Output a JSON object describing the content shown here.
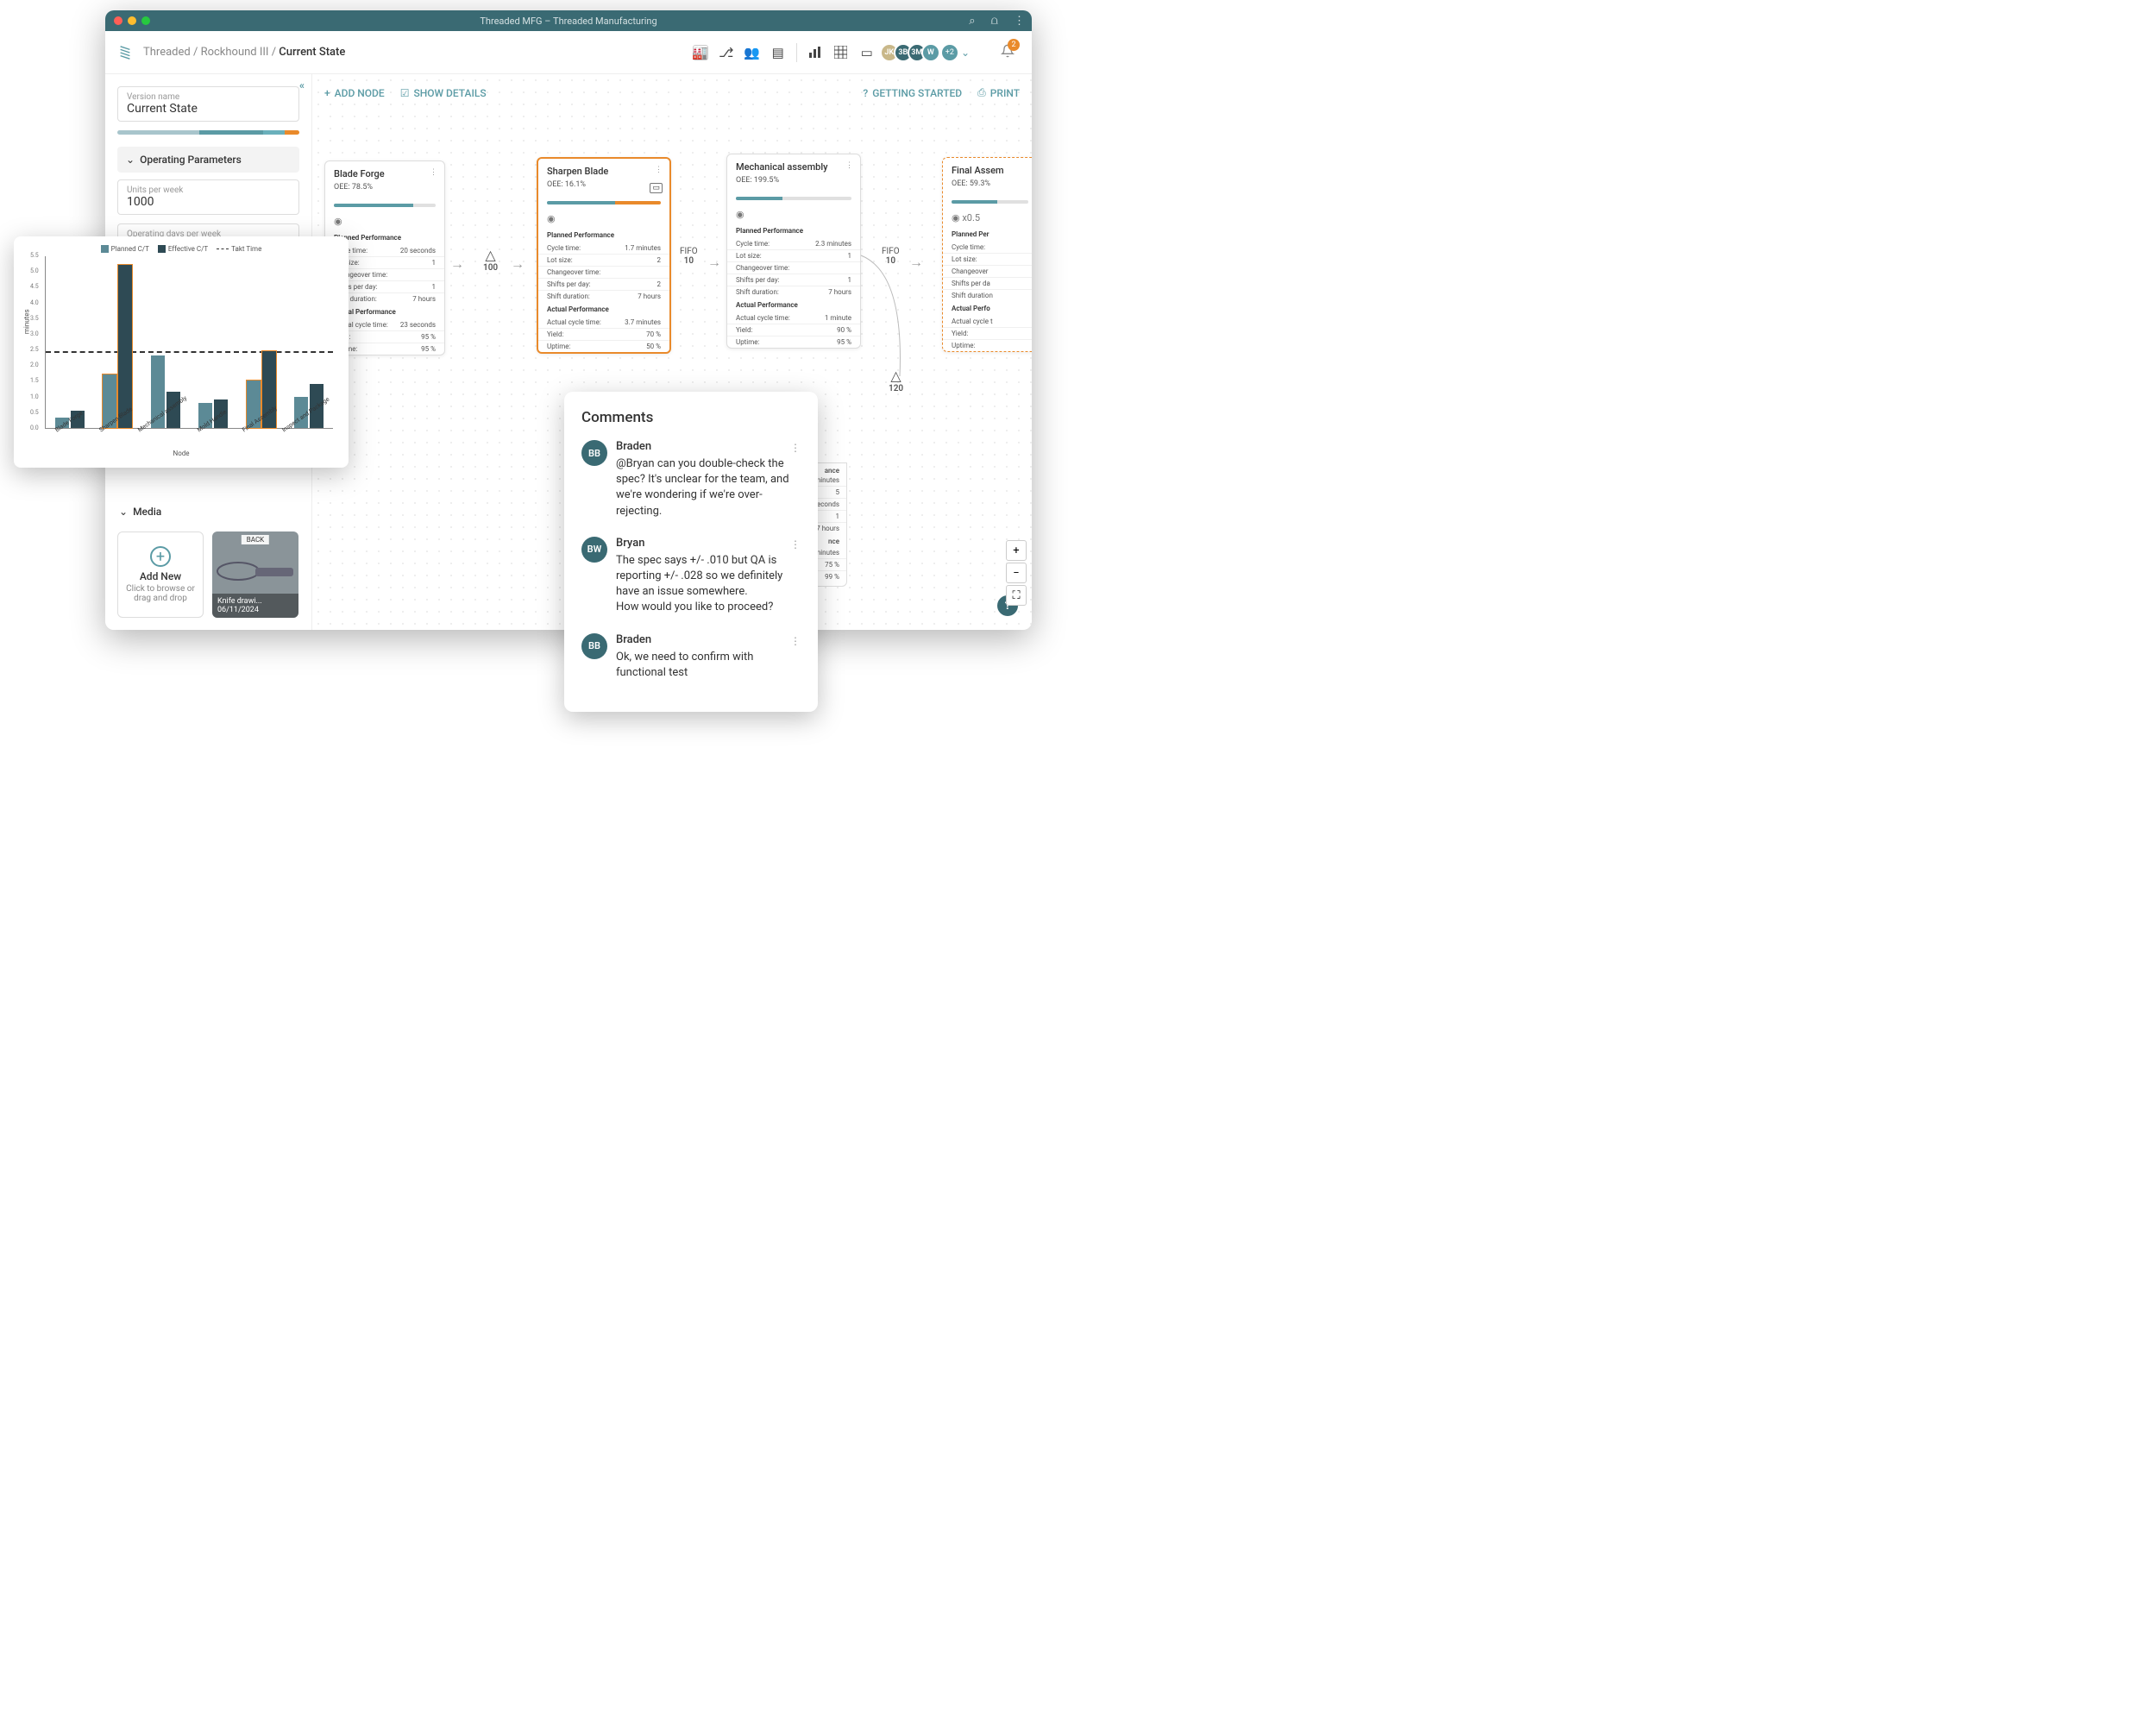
{
  "window_title": "Threaded MFG – Threaded Manufacturing",
  "breadcrumbs": {
    "root": "Threaded",
    "project": "Rockhound III",
    "current": "Current State"
  },
  "sidebar": {
    "version_label": "Version name",
    "version_value": "Current State",
    "op_params_title": "Operating Parameters",
    "units_label": "Units per week",
    "units_value": "1000",
    "days_label": "Operating days per week",
    "media_title": "Media",
    "add_new_title": "Add New",
    "add_new_sub": "Click to browse or drag and drop",
    "media_item_title": "Knife drawi...",
    "media_item_date": "06/11/2024",
    "media_item_tag": "BACK"
  },
  "toolbar": {
    "add_node": "ADD NODE",
    "show_details": "SHOW DETAILS",
    "getting_started": "GETTING STARTED",
    "print": "PRINT"
  },
  "avatars": [
    "JK",
    "3B",
    "3M",
    "W"
  ],
  "avatar_more": "+2",
  "notif_count": "2",
  "nodes": {
    "blade_forge": {
      "title": "Blade Forge",
      "oee": "OEE: 78.5%",
      "planned_title": "Planned Performance",
      "rows_p": [
        [
          "Cycle time:",
          "20 seconds"
        ],
        [
          "Lot size:",
          "1"
        ],
        [
          "Changeover time:",
          ""
        ],
        [
          "Shifts per day:",
          "1"
        ],
        [
          "Shift duration:",
          "7 hours"
        ]
      ],
      "actual_title": "Actual Performance",
      "rows_a": [
        [
          "Actual cycle time:",
          "23 seconds"
        ],
        [
          "Yield:",
          "95 %"
        ],
        [
          "Uptime:",
          "95 %"
        ]
      ]
    },
    "sharpen": {
      "title": "Sharpen Blade",
      "oee": "OEE: 16.1%",
      "planned_title": "Planned Performance",
      "rows_p": [
        [
          "Cycle time:",
          "1.7 minutes"
        ],
        [
          "Lot size:",
          "2"
        ],
        [
          "Changeover time:",
          ""
        ],
        [
          "Shifts per day:",
          "2"
        ],
        [
          "Shift duration:",
          "7 hours"
        ]
      ],
      "actual_title": "Actual Performance",
      "rows_a": [
        [
          "Actual cycle time:",
          "3.7 minutes"
        ],
        [
          "Yield:",
          "70 %"
        ],
        [
          "Uptime:",
          "50 %"
        ]
      ]
    },
    "mech": {
      "title": "Mechanical assembly",
      "oee": "OEE: 199.5%",
      "planned_title": "Planned Performance",
      "rows_p": [
        [
          "Cycle time:",
          "2.3 minutes"
        ],
        [
          "Lot size:",
          "1"
        ],
        [
          "Changeover time:",
          ""
        ],
        [
          "Shifts per day:",
          "1"
        ],
        [
          "Shift duration:",
          "7 hours"
        ]
      ],
      "actual_title": "Actual Performance",
      "rows_a": [
        [
          "Actual cycle time:",
          "1 minute"
        ],
        [
          "Yield:",
          "90 %"
        ],
        [
          "Uptime:",
          "95 %"
        ]
      ]
    },
    "final": {
      "title": "Final Assem",
      "oee": "OEE: 59.3%",
      "mult": "x0.5",
      "planned_title": "Planned Per",
      "rows_p": [
        [
          "Cycle time:",
          ""
        ],
        [
          "Lot size:",
          ""
        ],
        [
          "Changeover",
          ""
        ],
        [
          "Shifts per da",
          ""
        ],
        [
          "Shift duration",
          ""
        ]
      ],
      "actual_title": "Actual Perfo",
      "rows_a": [
        [
          "Actual cycle t",
          ""
        ],
        [
          "Yield:",
          ""
        ],
        [
          "Uptime:",
          ""
        ]
      ]
    },
    "hidden": {
      "rows1": [
        [
          "",
          "3 minutes"
        ],
        [
          "",
          "5"
        ],
        [
          "",
          "10 seconds"
        ],
        [
          "",
          "1"
        ],
        [
          "",
          "7 hours"
        ]
      ],
      "sec": "nce",
      "rows2": [
        [
          "",
          "3.1 minutes"
        ],
        [
          "",
          "75 %"
        ],
        [
          "",
          "99 %"
        ]
      ]
    }
  },
  "inv": {
    "tri1": "100",
    "fifo1_l": "FIFO",
    "fifo1_n": "10",
    "fifo2_l": "FIFO",
    "fifo2_n": "10",
    "tri2": "120"
  },
  "comments": {
    "title": "Comments",
    "items": [
      {
        "av": "BB",
        "name": "Braden",
        "text": "@Bryan can you double-check the spec?  It's unclear for the team, and we're wondering if we're over-rejecting."
      },
      {
        "av": "BW",
        "name": "Bryan",
        "text": "The spec says +/- .010 but QA is reporting +/- .028 so we definitely have an issue somewhere.\nHow would you like to proceed?"
      },
      {
        "av": "BB",
        "name": "Braden",
        "text": "Ok, we need to confirm with functional test"
      }
    ]
  },
  "chart_data": {
    "type": "bar",
    "title": "",
    "ylabel": "minutes",
    "xlabel": "Node",
    "takt_time": 2.4,
    "ylim": [
      0,
      5.5
    ],
    "yticks": [
      0,
      0.5,
      1.0,
      1.5,
      2.0,
      2.5,
      3.0,
      3.5,
      4.0,
      4.5,
      5.0,
      5.5
    ],
    "categories": [
      "Blade Forge",
      "Sharpen Blade",
      "Mechanical assembly",
      "Mold Handle",
      "Final Assembly",
      "Inspect and Package"
    ],
    "series": [
      {
        "name": "Planned C/T",
        "values": [
          0.33,
          1.7,
          2.3,
          0.8,
          1.5,
          1.0
        ]
      },
      {
        "name": "Effective C/T",
        "values": [
          0.55,
          5.2,
          1.15,
          0.9,
          2.45,
          1.4
        ]
      }
    ],
    "legend": [
      "Planned C/T",
      "Effective C/T",
      "Takt Time"
    ]
  }
}
